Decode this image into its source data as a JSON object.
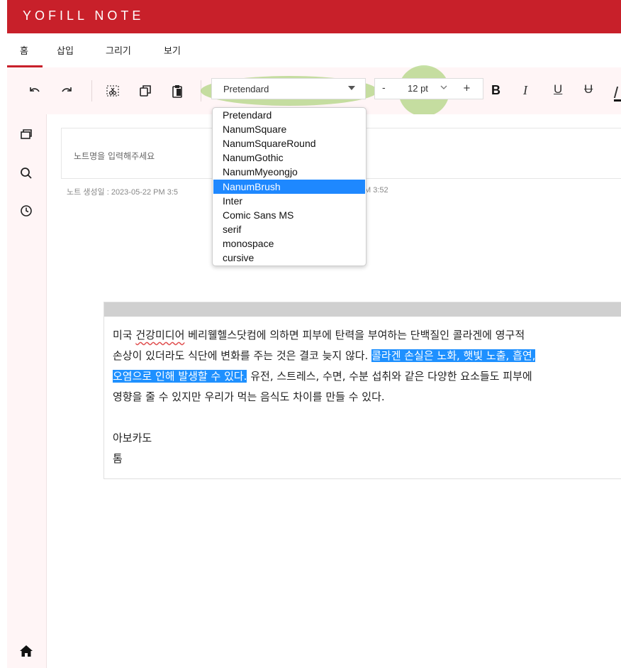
{
  "app": {
    "title": "YOFILL NOTE"
  },
  "menu": {
    "items": [
      "홈",
      "삽입",
      "그리기",
      "보기"
    ]
  },
  "toolbar": {
    "font_value": "Pretendard",
    "size_minus": "-",
    "size_value": "12 pt",
    "size_plus": "+",
    "bold": "B",
    "italic": "I",
    "underline": "U",
    "strike": "U"
  },
  "font_dropdown": {
    "options": [
      "Pretendard",
      "NanumSquare",
      "NanumSquareRound",
      "NanumGothic",
      "NanumMyeongjo",
      "NanumBrush",
      "Inter",
      "Comic Sans MS",
      "serif",
      "monospace",
      "cursive"
    ],
    "selected": "NanumBrush"
  },
  "note": {
    "name_placeholder": "노트명을 입력해주세요",
    "created": "노트 생성일 : 2023-05-22 PM 3:5",
    "modified_tail": "M 3:52"
  },
  "editor": {
    "line1_a": "미국 ",
    "line1_b": "건강미디어",
    "line1_c": " 베리웰헬스닷컴에 의하면 피부에 탄력을 부여하는 단백질인 콜라겐에 영구적",
    "line2_a": "손상이 있더라도 식단에 변화를 주는 것은 결코 늦지 않다. ",
    "line2_b": "콜라겐 손실은 노화, 햇빛 노출, 흡연,",
    "line3_a": "오염으로 인해 발생할 수 있다.",
    "line3_b": " 유전, 스트레스, 수면, 수분 섭취와 같은 다양한 요소들도 피부에",
    "line4": "영향을 줄 수 있지만 우리가 먹는 음식도 차이를 만들 수 있다.",
    "line6": "아보카도",
    "line7": "톰"
  },
  "colors": {
    "brand": "#c8202a",
    "selection": "#1e90ff",
    "highlight": "#96c85a"
  },
  "icons": [
    "undo-icon",
    "redo-icon",
    "cut-icon",
    "copy-icon",
    "paste-icon",
    "bold-icon",
    "italic-icon",
    "underline-icon",
    "strikethrough-icon",
    "pages-icon",
    "search-icon",
    "clock-icon",
    "home-icon"
  ]
}
